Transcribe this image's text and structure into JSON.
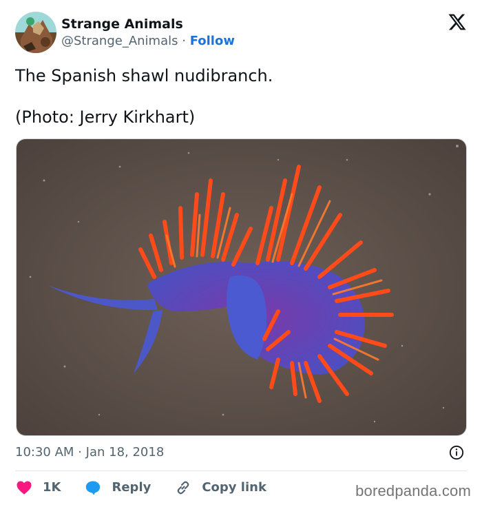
{
  "author": {
    "name": "Strange Animals",
    "handle": "@Strange_Animals",
    "separator": "·",
    "follow_label": "Follow"
  },
  "tweet": {
    "text_line1": "The Spanish shawl nudibranch.",
    "text_line2": "(Photo: Jerry Kirkhart)",
    "time": "10:30 AM",
    "date_separator": "·",
    "date": "Jan 18, 2018"
  },
  "actions": {
    "like_count": "1K",
    "reply_label": "Reply",
    "copy_link_label": "Copy link"
  },
  "watermark": "boredpanda.com",
  "icons": {
    "platform_logo": "x-logo-icon",
    "info": "info-icon",
    "like": "heart-icon",
    "reply": "speech-bubble-icon",
    "copy": "link-icon"
  },
  "colors": {
    "follow": "#1d73d9",
    "heart": "#f91880",
    "reply": "#1d9bf0",
    "text": "#0f1419",
    "muted": "#536471"
  }
}
